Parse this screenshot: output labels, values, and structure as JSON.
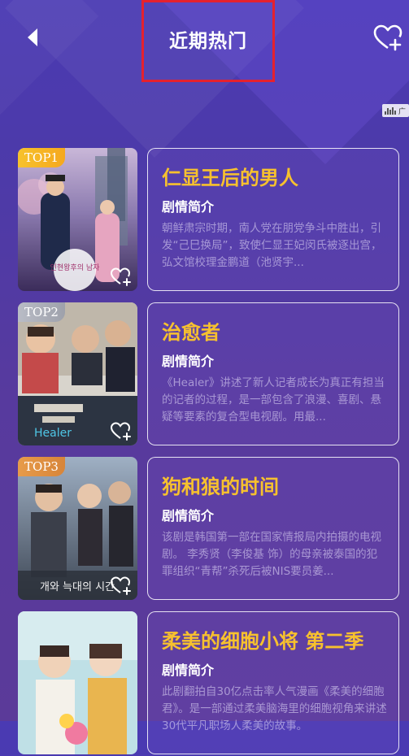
{
  "header": {
    "title": "近期热门",
    "back_icon": "back-arrow-icon",
    "favorite_icon": "heart-add-icon"
  },
  "ad_chip": {
    "text": "广"
  },
  "colors": {
    "accent_title": "#f7c12e",
    "highlight_box": "#e5212e",
    "top1": "#f5b424",
    "top2": "#aeb1bb",
    "top3": "#e08f42"
  },
  "items": [
    {
      "rank": "TOP1",
      "title": "仁显王后的男人",
      "label": "剧情简介",
      "desc": "朝鲜肃宗时期，南人党在朋党争斗中胜出，引发“己巳换局”，致使仁显王妃闵氏被逐出宫，弘文馆校理金鹏道（池贤宇...",
      "poster_text": "인현왕후의 남자"
    },
    {
      "rank": "TOP2",
      "title": "治愈者",
      "label": "剧情简介",
      "desc": "《Healer》讲述了新人记者成长为真正有担当的记者的过程，是一部包含了浪漫、喜剧、悬疑等要素的复合型电视剧。用最...",
      "poster_text": "Healer"
    },
    {
      "rank": "TOP3",
      "title": "狗和狼的时间",
      "label": "剧情简介",
      "desc": "该剧是韩国第一部在国家情报局内拍摄的电视剧。 李秀贤（李俊基 饰）的母亲被泰国的犯罪组织“青帮”杀死后被NIS要员姜...",
      "poster_text": "개와 늑대의 시간"
    },
    {
      "rank": "",
      "title": "柔美的细胞小将 第二季",
      "label": "剧情简介",
      "desc": "此剧翻拍自30亿点击率人气漫画《柔美的细胞君》。是一部通过柔美脑海里的细胞视角来讲述30代平凡职场人柔美的故事。",
      "poster_text": ""
    }
  ]
}
